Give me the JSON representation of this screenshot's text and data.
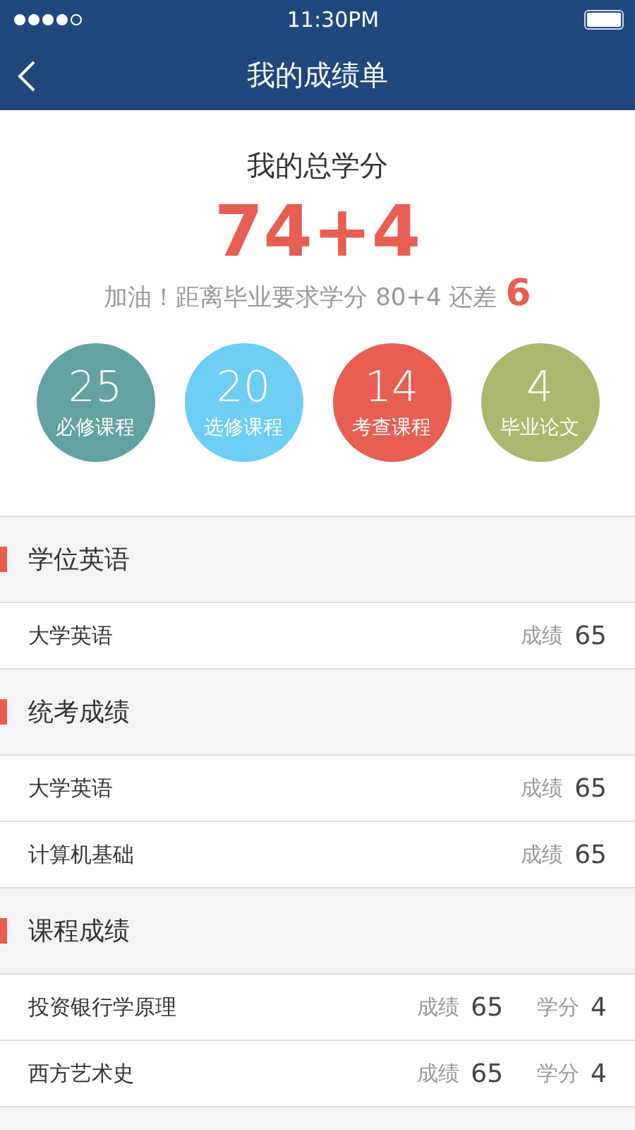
{
  "status_bar": {
    "time": "11:30PM"
  },
  "nav": {
    "title": "我的成绩单"
  },
  "summary": {
    "heading": "我的总学分",
    "total": "74+4",
    "message": "加油！距离毕业要求学分 80+4 还差",
    "gap": "6"
  },
  "stats": [
    {
      "value": "25",
      "label": "必修课程",
      "color": "#64a1a1"
    },
    {
      "value": "20",
      "label": "选修课程",
      "color": "#6dcdf2"
    },
    {
      "value": "14",
      "label": "考查课程",
      "color": "#e65f52"
    },
    {
      "value": "4",
      "label": "毕业论文",
      "color": "#a9b86e"
    }
  ],
  "sections": [
    {
      "title": "学位英语",
      "rows": [
        {
          "course": "大学英语",
          "score_label": "成绩",
          "score": "65"
        }
      ]
    },
    {
      "title": "统考成绩",
      "rows": [
        {
          "course": "大学英语",
          "score_label": "成绩",
          "score": "65"
        },
        {
          "course": "计算机基础",
          "score_label": "成绩",
          "score": "65"
        }
      ]
    },
    {
      "title": "课程成绩",
      "rows": [
        {
          "course": "投资银行学原理",
          "score_label": "成绩",
          "score": "65",
          "credit_label": "学分",
          "credit": "4"
        },
        {
          "course": "西方艺术史",
          "score_label": "成绩",
          "score": "65",
          "credit_label": "学分",
          "credit": "4"
        }
      ]
    }
  ]
}
